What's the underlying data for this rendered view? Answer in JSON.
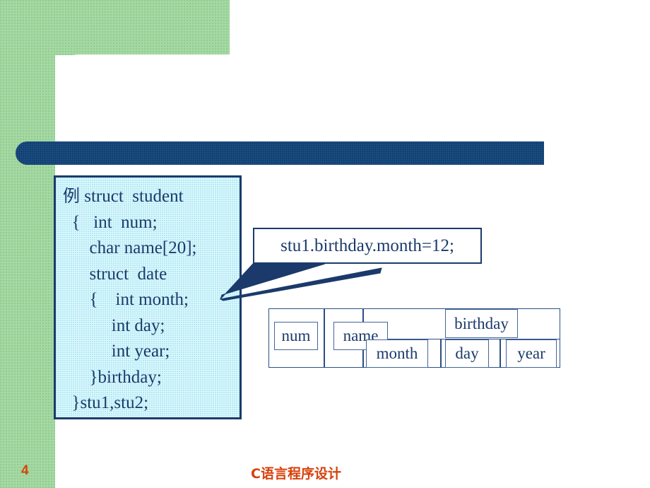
{
  "slide": {
    "page_number": "4",
    "footer_title": "C语言程序设计",
    "colors": {
      "green": "#a5d8a3",
      "navy": "#103f72",
      "code_border": "#1b3a6b",
      "code_background": "#e2f7fb",
      "accent_red": "#d7410b"
    }
  },
  "title_bar": {
    "label": ""
  },
  "code_box": {
    "lines": [
      "例 struct  student",
      "  {   int  num;",
      "      char name[20];",
      "      struct  date",
      "      {    int month;",
      "           int day;",
      "           int year;",
      "      }birthday;",
      "  }stu1,stu2;"
    ],
    "line1_cjk": "例",
    "line1_rest": " struct  student",
    "line2": "  {   int  num;",
    "line3": "      char name[20];",
    "line4": "      struct  date",
    "line5": "      {    int month;",
    "line6": "           int day;",
    "line7": "           int year;",
    "line8": "      }birthday;",
    "line9": "  }stu1,stu2;"
  },
  "callout": {
    "text": "stu1.birthday.month=12;"
  },
  "struct_table": {
    "fields": [
      {
        "name": "num"
      },
      {
        "name": "name"
      },
      {
        "name": "birthday"
      }
    ],
    "birthday_subfields": [
      {
        "name": "month"
      },
      {
        "name": "day"
      },
      {
        "name": "year"
      }
    ],
    "labels": {
      "num": "num",
      "name": "name",
      "birthday": "birthday",
      "month": "month",
      "day": "day",
      "year": "year"
    }
  }
}
